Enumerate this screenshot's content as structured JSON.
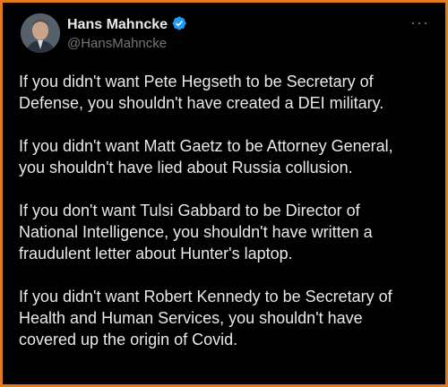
{
  "author": {
    "display_name": "Hans Mahncke",
    "handle": "@HansMahncke",
    "verified": true,
    "avatar_icon": "profile-photo"
  },
  "menu": {
    "icon": "more-horizontal-icon",
    "glyph": "···"
  },
  "tweet": {
    "paragraphs": [
      {
        "lines": [
          "If you didn't want Pete Hegseth to be Secretary of",
          "Defense, you shouldn't have created a DEI military."
        ]
      },
      {
        "lines": [
          "If you didn't want Matt Gaetz to be Attorney General,",
          "you shouldn't have lied about Russia collusion."
        ]
      },
      {
        "lines": [
          "If you don't want Tulsi Gabbard to be Director of",
          "National Intelligence, you shouldn't have written a",
          "fraudulent letter about Hunter's laptop."
        ]
      },
      {
        "lines": [
          "If you didn't want Robert Kennedy to be Secretary of",
          "Health and Human Services, you shouldn't have",
          "covered up the origin of Covid."
        ]
      }
    ]
  },
  "colors": {
    "background": "#000000",
    "border": "#e07b1f",
    "text": "#e7e9ea",
    "muted": "#71767b",
    "verified": "#1d9bf0"
  }
}
